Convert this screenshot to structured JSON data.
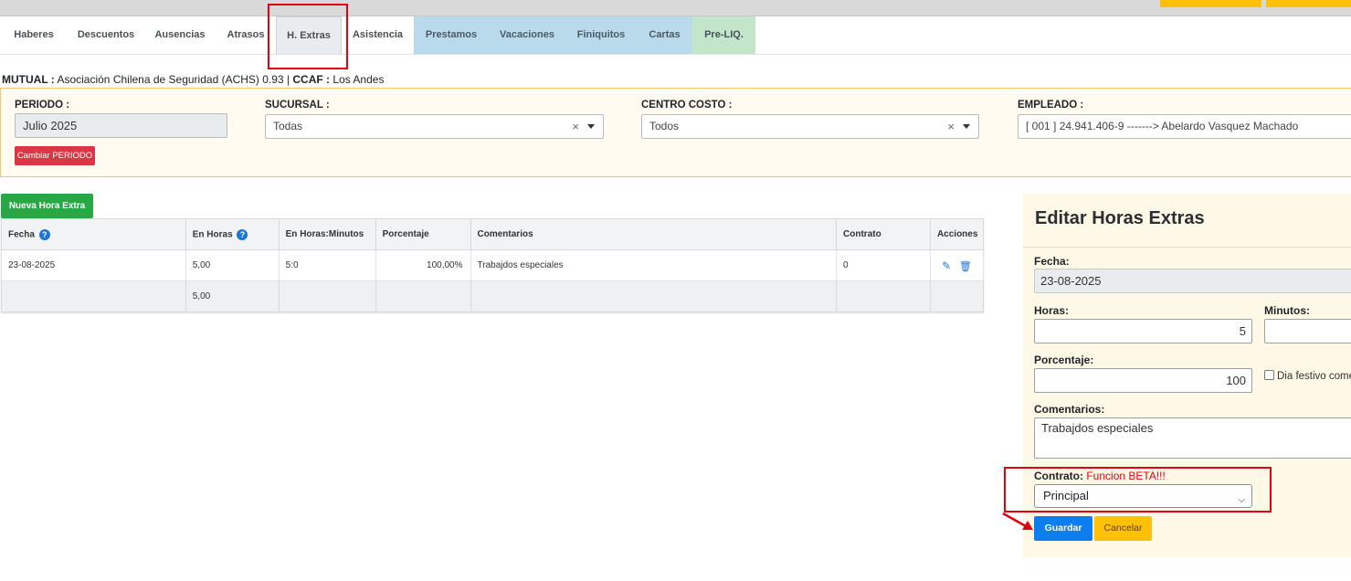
{
  "tabs": [
    {
      "label": "Haberes"
    },
    {
      "label": "Descuentos"
    },
    {
      "label": "Ausencias"
    },
    {
      "label": "Atrasos"
    },
    {
      "label": "H. Extras",
      "active": true
    },
    {
      "label": "Asistencia"
    },
    {
      "label": "Prestamos"
    },
    {
      "label": "Vacaciones"
    },
    {
      "label": "Finiquitos"
    },
    {
      "label": "Cartas"
    },
    {
      "label": "Pre-LIQ."
    }
  ],
  "mutual": {
    "mutual_label": "MUTUAL :",
    "mutual_value": "Asociación Chilena de Seguridad (ACHS) 0.93 |",
    "ccaf_label": "CCAF :",
    "ccaf_value": "Los Andes"
  },
  "filters": {
    "periodo_label": "PERIODO :",
    "periodo_value": "Julio 2025",
    "sucursal_label": "SUCURSAL :",
    "sucursal_value": "Todas",
    "centro_label": "CENTRO COSTO :",
    "centro_value": "Todos",
    "empleado_label": "EMPLEADO :",
    "empleado_value": "[ 001 ] 24.941.406-9 -------> Abelardo Vasquez Machado",
    "clear_glyph": "×",
    "cambiar_button": "Cambiar PERIODO"
  },
  "list": {
    "new_button": "Nueva Hora Extra",
    "columns": [
      "Fecha",
      "En Horas",
      "En Horas:Minutos",
      "Porcentaje",
      "Comentarios",
      "Contrato",
      "Acciones"
    ],
    "rows": [
      {
        "fecha": "23-08-2025",
        "horas": "5,00",
        "hm": "5:0",
        "porcentaje": "100,00%",
        "comentarios": "Trabajdos especiales",
        "contrato": "0"
      }
    ],
    "total_horas": "5,00",
    "help_glyph": "?",
    "edit_icon": "✎",
    "delete_icon": "🗑"
  },
  "edit": {
    "title": "Editar Horas Extras",
    "fecha_label": "Fecha:",
    "fecha_value": "23-08-2025",
    "horas_label": "Horas:",
    "horas_value": "5",
    "minutos_label": "Minutos:",
    "minutos_value": "",
    "porcentaje_label": "Porcentaje:",
    "porcentaje_value": "100",
    "festivo_label": "Dia festivo come",
    "comentarios_label": "Comentarios:",
    "comentarios_value": "Trabajdos especiales",
    "contrato_label": "Contrato:",
    "contrato_beta": "Funcion BETA!!!",
    "contrato_value": "Principal",
    "guardar_button": "Guardar",
    "cancelar_button": "Cancelar"
  },
  "colors": {
    "highlight": "#e3000f",
    "primary": "#0d7ef0",
    "success": "#28a745",
    "danger": "#dc3545",
    "warning": "#ffc107"
  }
}
